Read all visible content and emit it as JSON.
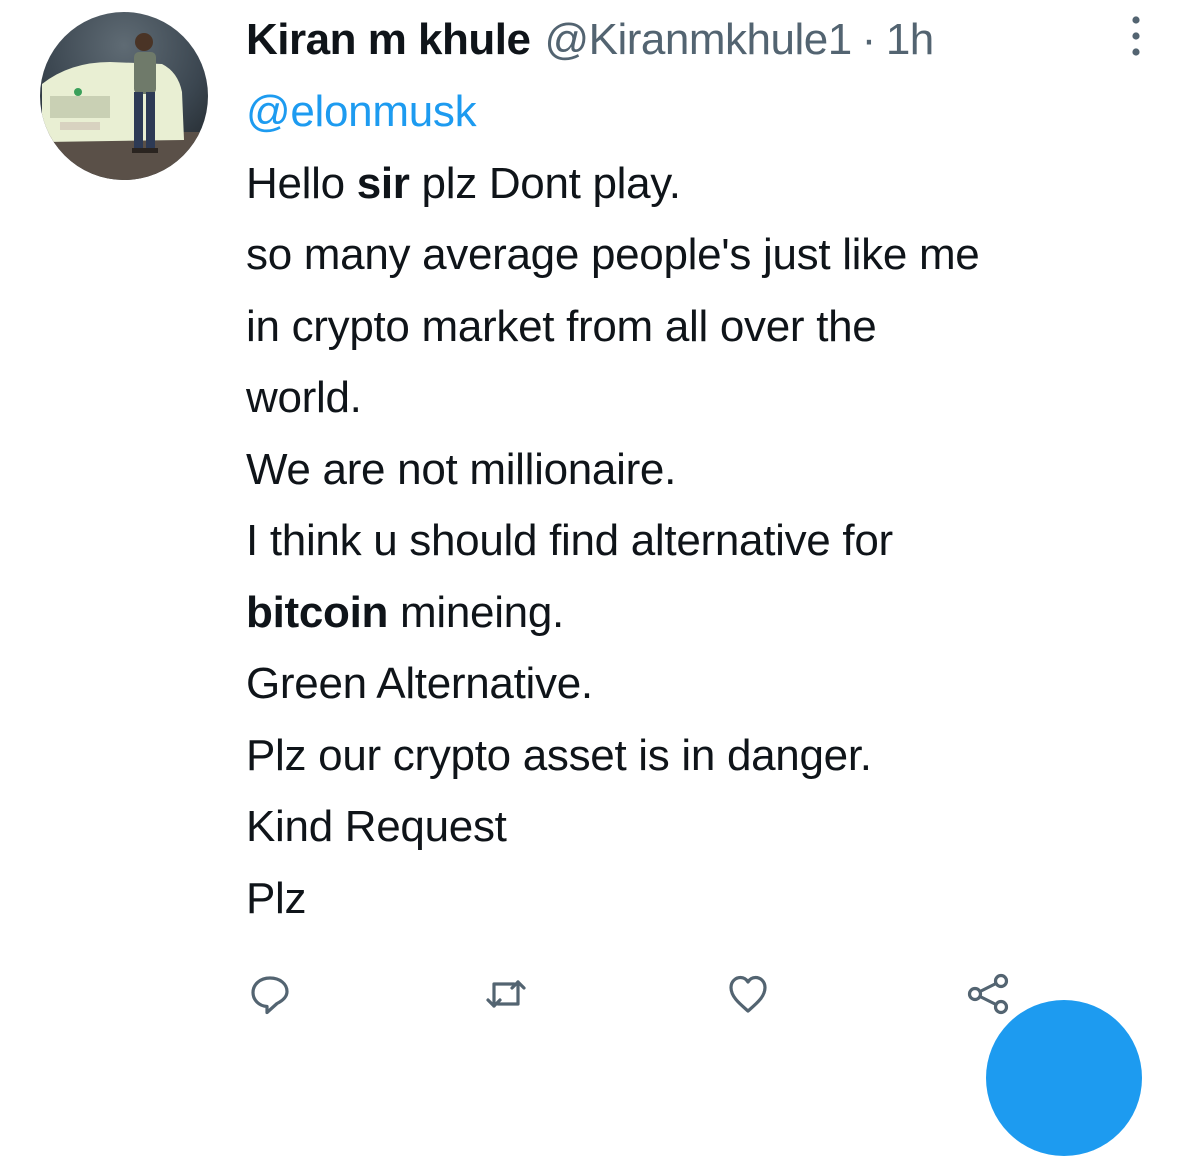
{
  "tweet": {
    "display_name": "Kiran m khule",
    "handle": "@Kiranmkhule1",
    "separator": "·",
    "time": "1h",
    "mention": "@elonmusk",
    "lines": [
      {
        "before": "Hello ",
        "bold": "sir",
        "after": " plz Dont play."
      },
      {
        "text": "so many average people's just like me"
      },
      {
        "text": "in crypto market from all over the"
      },
      {
        "text": "world."
      },
      {
        "text": "We are not millionaire."
      },
      {
        "text": "I think u should find alternative for"
      },
      {
        "bold": "bitcoin",
        "after": " mineing."
      },
      {
        "text": "Green Alternative."
      },
      {
        "text": "Plz our crypto asset is in danger."
      },
      {
        "text": "Kind Request"
      },
      {
        "text": "Plz"
      }
    ]
  },
  "icons": {
    "more": "more-vertical-icon",
    "reply": "reply-icon",
    "retweet": "retweet-icon",
    "like": "heart-icon",
    "share": "share-icon",
    "compose": "compose-fab"
  },
  "colors": {
    "text": "#0f1419",
    "secondary": "#536471",
    "accent": "#1d9bf0",
    "background": "#ffffff"
  }
}
